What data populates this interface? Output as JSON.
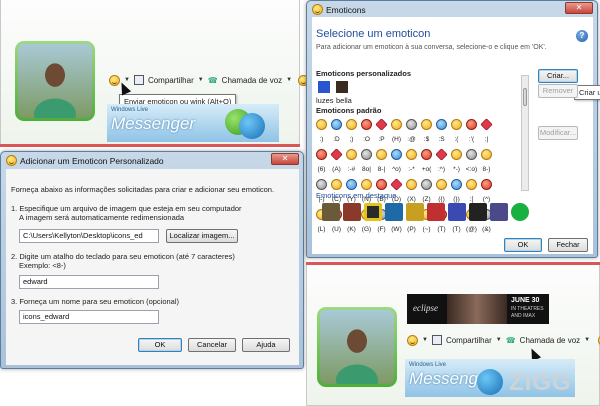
{
  "top_chat": {
    "toolbar": {
      "share_label": "Compartilhar",
      "voice_label": "Chamada de voz"
    },
    "tooltip": "Enviar emoticon ou wink (Alt+O)",
    "ad": {
      "small": "Windows Live",
      "word": "Messenger"
    }
  },
  "add_dialog": {
    "title": "Adicionar um Emoticon Personalizado",
    "intro": "Forneça abaixo as informações solicitadas para criar e adicionar seu emoticon.",
    "step1_line1": "1. Especifique um arquivo de imagem que esteja em seu computador",
    "step1_line2": "A imagem será automaticamente redimensionada",
    "path_value": "C:\\Users\\Kellyton\\Desktop\\icons_ed",
    "browse_label": "Localizar imagem...",
    "step2_line1": "2. Digite um atalho do teclado para seu emoticon (até 7 caracteres)",
    "step2_line2": "Exemplo: <8-)",
    "shortcut_value": "edward",
    "step3_line1": "3. Forneça um nome para seu emoticon (opcional)",
    "name_value": "icons_edward",
    "ok_label": "OK",
    "cancel_label": "Cancelar",
    "help_label": "Ajuda"
  },
  "emoticons_window": {
    "title": "Emoticons",
    "heading": "Selecione um emoticon",
    "subtitle": "Para adicionar um emoticon à sua conversa, selecione-o e clique em 'OK'.",
    "custom_section": "Emoticons personalizados",
    "custom_items": [
      "luzes",
      "bella"
    ],
    "standard_section": "Emoticons padrão",
    "standard_codes": [
      ":)",
      ":D",
      ";)",
      ":O",
      ":P",
      "(H)",
      ":@",
      ":$",
      ":S",
      ":(",
      ":'(",
      ":|",
      "(6)",
      "(A)",
      ":-#",
      "8o|",
      "8-|",
      "^o)",
      ":-*",
      "+o(",
      ":^)",
      "*-)",
      "<:o)",
      "8-)",
      "|-)",
      "(C)",
      "(Y)",
      "(N)",
      "(B)",
      "(D)",
      "(X)",
      "(Z)",
      "({)",
      "(})",
      ":[",
      "(^)",
      "(L)",
      "(U)",
      "(K)",
      "(G)",
      "(F)",
      "(W)",
      "(P)",
      "(~)",
      "(T)",
      "(T)",
      "(@)",
      "(&)"
    ],
    "featured_section": "Emoticons em destaque",
    "create_label": "Criar...",
    "remove_label": "Remover",
    "modify_label": "Modificar...",
    "tooltip_partial": "Criar um",
    "ok_label": "OK",
    "close_label": "Fechar"
  },
  "bottom_chat": {
    "toolbar": {
      "share_label": "Compartilhar",
      "voice_label": "Chamada de voz"
    },
    "banner": {
      "text1": "eclipse",
      "text2": "JUNE 30",
      "text3": "IN THEATRES",
      "text4": "AND IMAX"
    },
    "ad": {
      "small": "Windows Live",
      "word": "Messenger"
    },
    "watermark": "ZIGG"
  },
  "colors": {
    "accent_red": "#d95757",
    "title_blue": "#1e4e9a",
    "glass": "#a9c2d9"
  }
}
